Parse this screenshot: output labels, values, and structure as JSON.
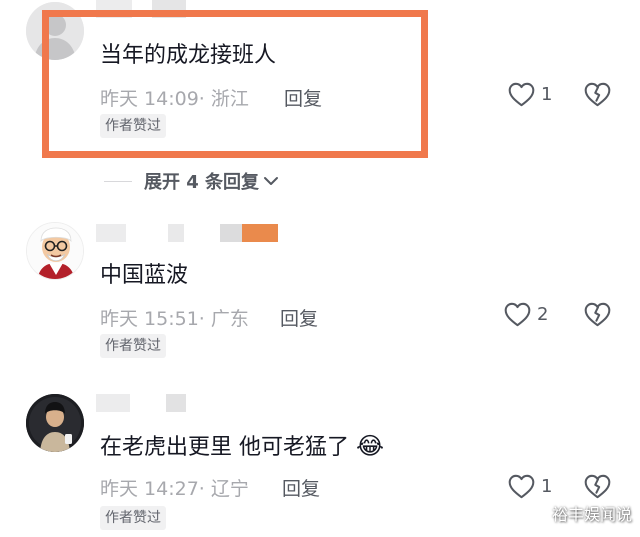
{
  "comments": [
    {
      "text": "当年的成龙接班人",
      "time": "昨天 14:09",
      "location": "· 浙江",
      "reply": "回复",
      "likes": "1",
      "badge": "作者赞过"
    },
    {
      "text": "中国蓝波",
      "time": "昨天 15:51",
      "location": "· 广东",
      "reply": "回复",
      "likes": "2",
      "badge": "作者赞过"
    },
    {
      "text": "在老虎出更里 他可老猛了",
      "emoji": "😂",
      "time": "昨天 14:27",
      "location": "· 辽宁",
      "reply": "回复",
      "likes": "1",
      "badge": "作者赞过"
    }
  ],
  "expand_replies": "展开 4 条回复",
  "watermark": "裕丰娱闻说",
  "colors": {
    "highlight": "#f0784c",
    "meta": "#a7a8ad",
    "badge_bg": "#f1f1f2"
  },
  "icons": [
    "default-avatar-icon",
    "heart-icon",
    "broken-heart-icon",
    "chevron-down-icon",
    "laughing-emoji-icon"
  ]
}
